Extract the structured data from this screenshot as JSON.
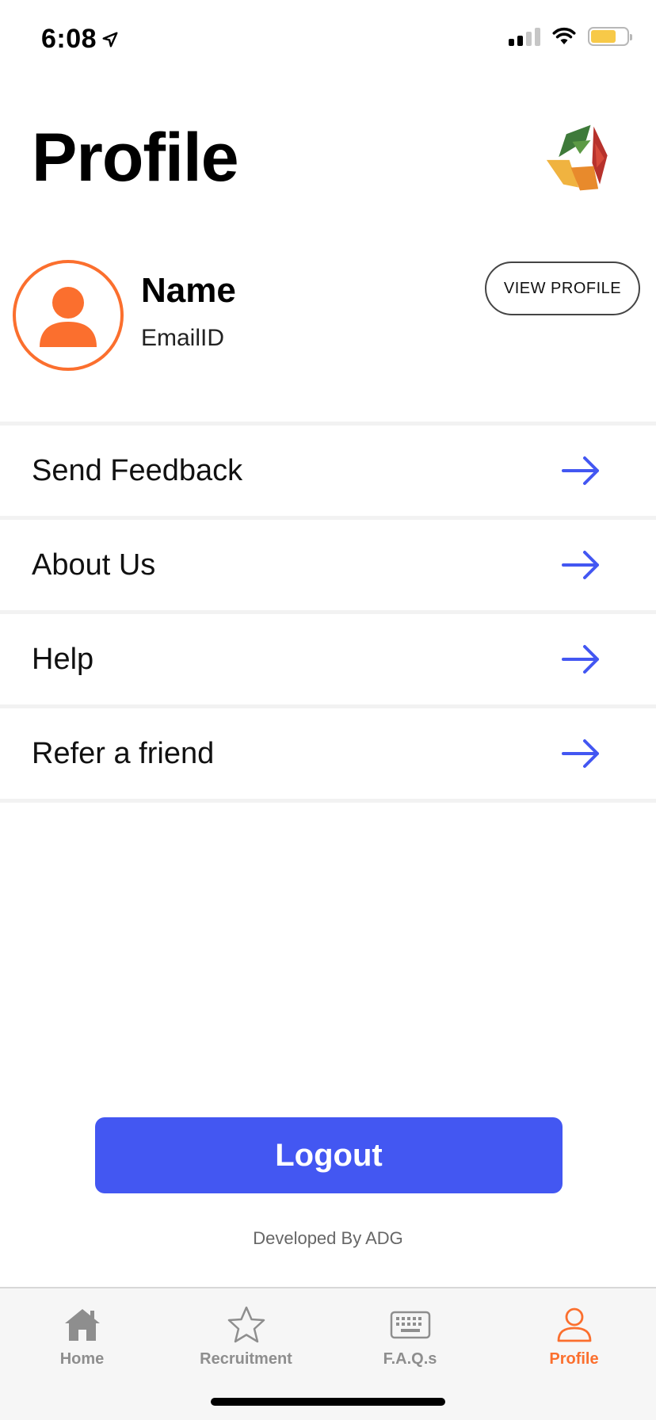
{
  "status_bar": {
    "time": "6:08",
    "location_icon": "location-arrow-icon",
    "signal_icon": "cellular-signal-icon",
    "wifi_icon": "wifi-icon",
    "battery_icon": "battery-icon",
    "battery_color": "#f7c948"
  },
  "header": {
    "title": "Profile",
    "logo_icon": "app-logo-icon"
  },
  "profile": {
    "name": "Name",
    "email": "EmailID",
    "avatar_icon": "user-avatar-icon",
    "view_profile_label": "VIEW PROFILE"
  },
  "menu": {
    "items": [
      {
        "label": "Send Feedback",
        "icon": "arrow-right-icon"
      },
      {
        "label": "About Us",
        "icon": "arrow-right-icon"
      },
      {
        "label": "Help",
        "icon": "arrow-right-icon"
      },
      {
        "label": "Refer a friend",
        "icon": "arrow-right-icon"
      }
    ]
  },
  "logout": {
    "label": "Logout"
  },
  "footer": {
    "credit": "Developed By ADG"
  },
  "tabbar": {
    "tabs": [
      {
        "label": "Home",
        "icon": "home-icon",
        "active": false
      },
      {
        "label": "Recruitment",
        "icon": "star-icon",
        "active": false
      },
      {
        "label": "F.A.Q.s",
        "icon": "keyboard-icon",
        "active": false
      },
      {
        "label": "Profile",
        "icon": "person-icon",
        "active": true
      }
    ]
  },
  "colors": {
    "accent_orange": "#fb6f2e",
    "primary_blue": "#4357f2",
    "arrow_blue": "#4357f2"
  }
}
